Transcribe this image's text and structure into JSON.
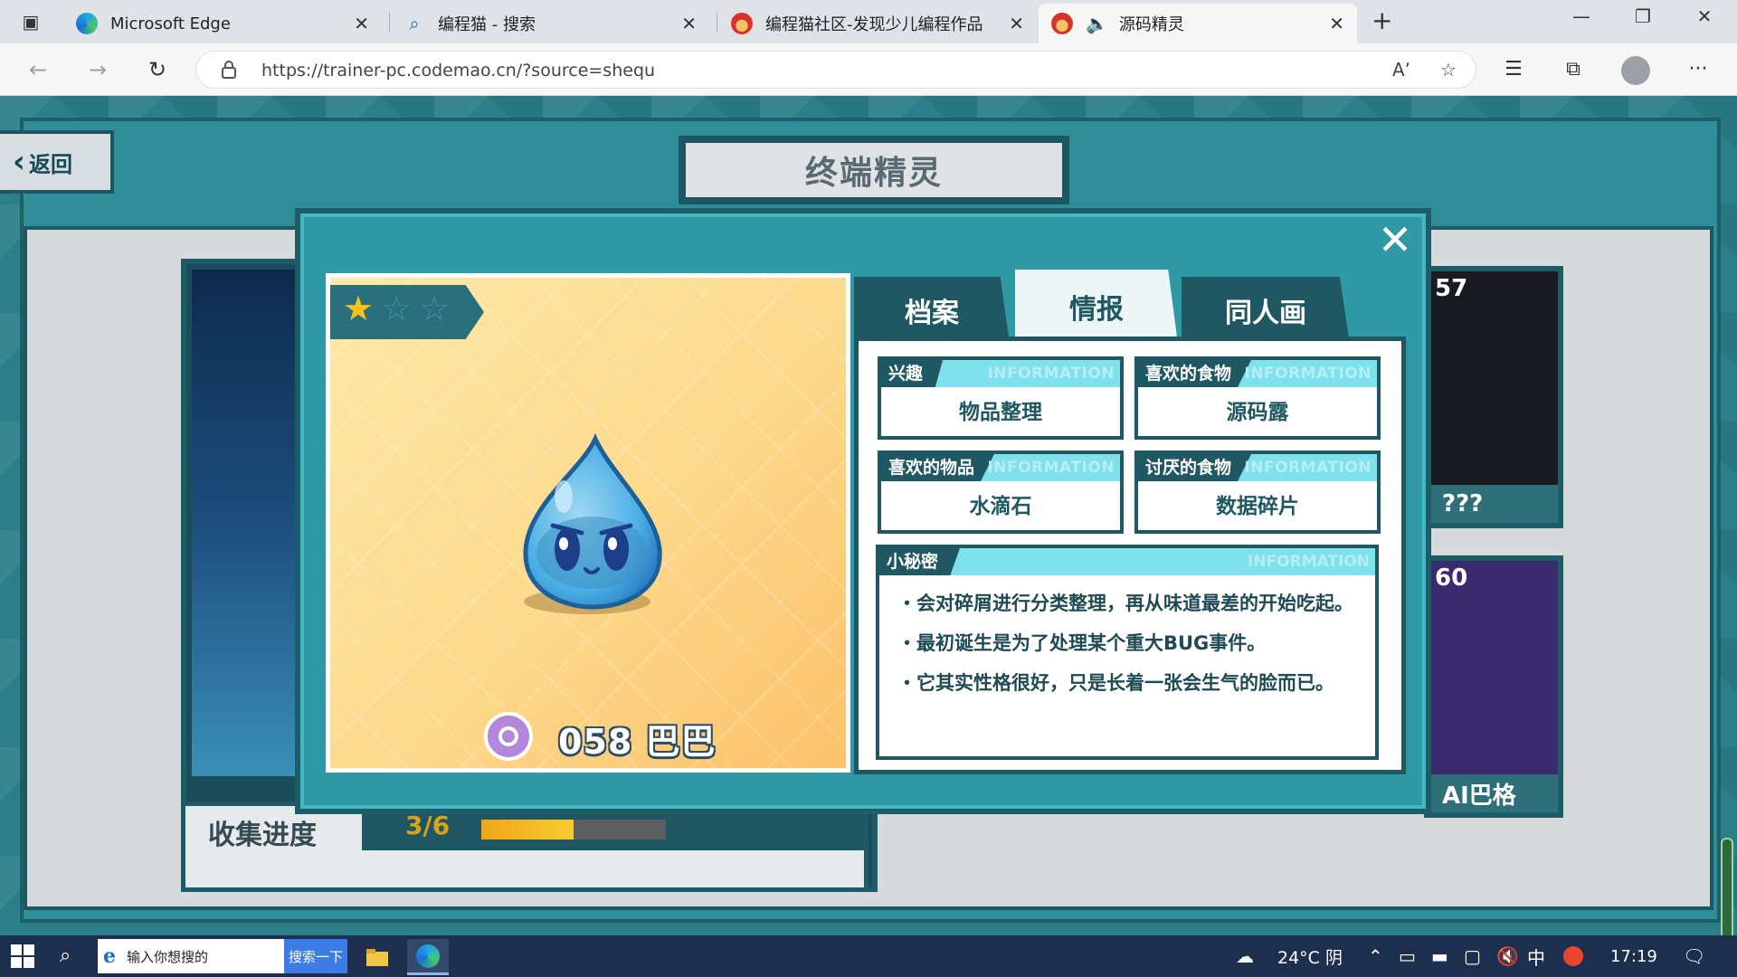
{
  "browser": {
    "tabs": [
      {
        "title": "Microsoft Edge",
        "icon": "edge-icon"
      },
      {
        "title": "编程猫 - 搜索",
        "icon": "search-icon"
      },
      {
        "title": "编程猫社区-发现少儿编程作品",
        "icon": "codemao-icon"
      },
      {
        "title": "源码精灵",
        "icon": "codemao-icon",
        "active": true,
        "audio": true
      }
    ],
    "url": "https://trainer-pc.codemao.cn/?source=shequ"
  },
  "game": {
    "back_label": "返回",
    "title": "终端精灵",
    "collection_label": "收集进度",
    "collection_count": "3/6",
    "collection_progress": 0.5,
    "side_cards": [
      {
        "number": "57",
        "name": "???"
      },
      {
        "number": "60",
        "name": "AI巴格"
      }
    ]
  },
  "modal": {
    "stars_filled": 1,
    "stars_total": 3,
    "sprite_name": "058 巴巴",
    "tabs": [
      {
        "label": "档案",
        "active": false
      },
      {
        "label": "情报",
        "active": true
      },
      {
        "label": "同人画",
        "active": false
      }
    ],
    "watermark": "INFORMATION",
    "fields": [
      {
        "label": "兴趣",
        "value": "物品整理"
      },
      {
        "label": "喜欢的食物",
        "value": "源码露"
      },
      {
        "label": "喜欢的物品",
        "value": "水滴石"
      },
      {
        "label": "讨厌的食物",
        "value": "数据碎片"
      }
    ],
    "secret": {
      "label": "小秘密",
      "lines": [
        "・会对碎屑进行分类整理，再从味道最差的开始吃起。",
        "・最初诞生是为了处理某个重大BUG事件。",
        "・它其实性格很好，只是长着一张会生气的脸而已。"
      ]
    }
  },
  "taskbar": {
    "search_placeholder": "输入你想搜的",
    "search_button": "搜索一下",
    "weather": "24°C 阴",
    "ime": "中",
    "time": "17:19"
  },
  "colors": {
    "accent_teal": "#2f9aa6",
    "dark_teal": "#1f5862",
    "light_cyan": "#7fe1ec",
    "star_gold": "#f6c21b"
  }
}
